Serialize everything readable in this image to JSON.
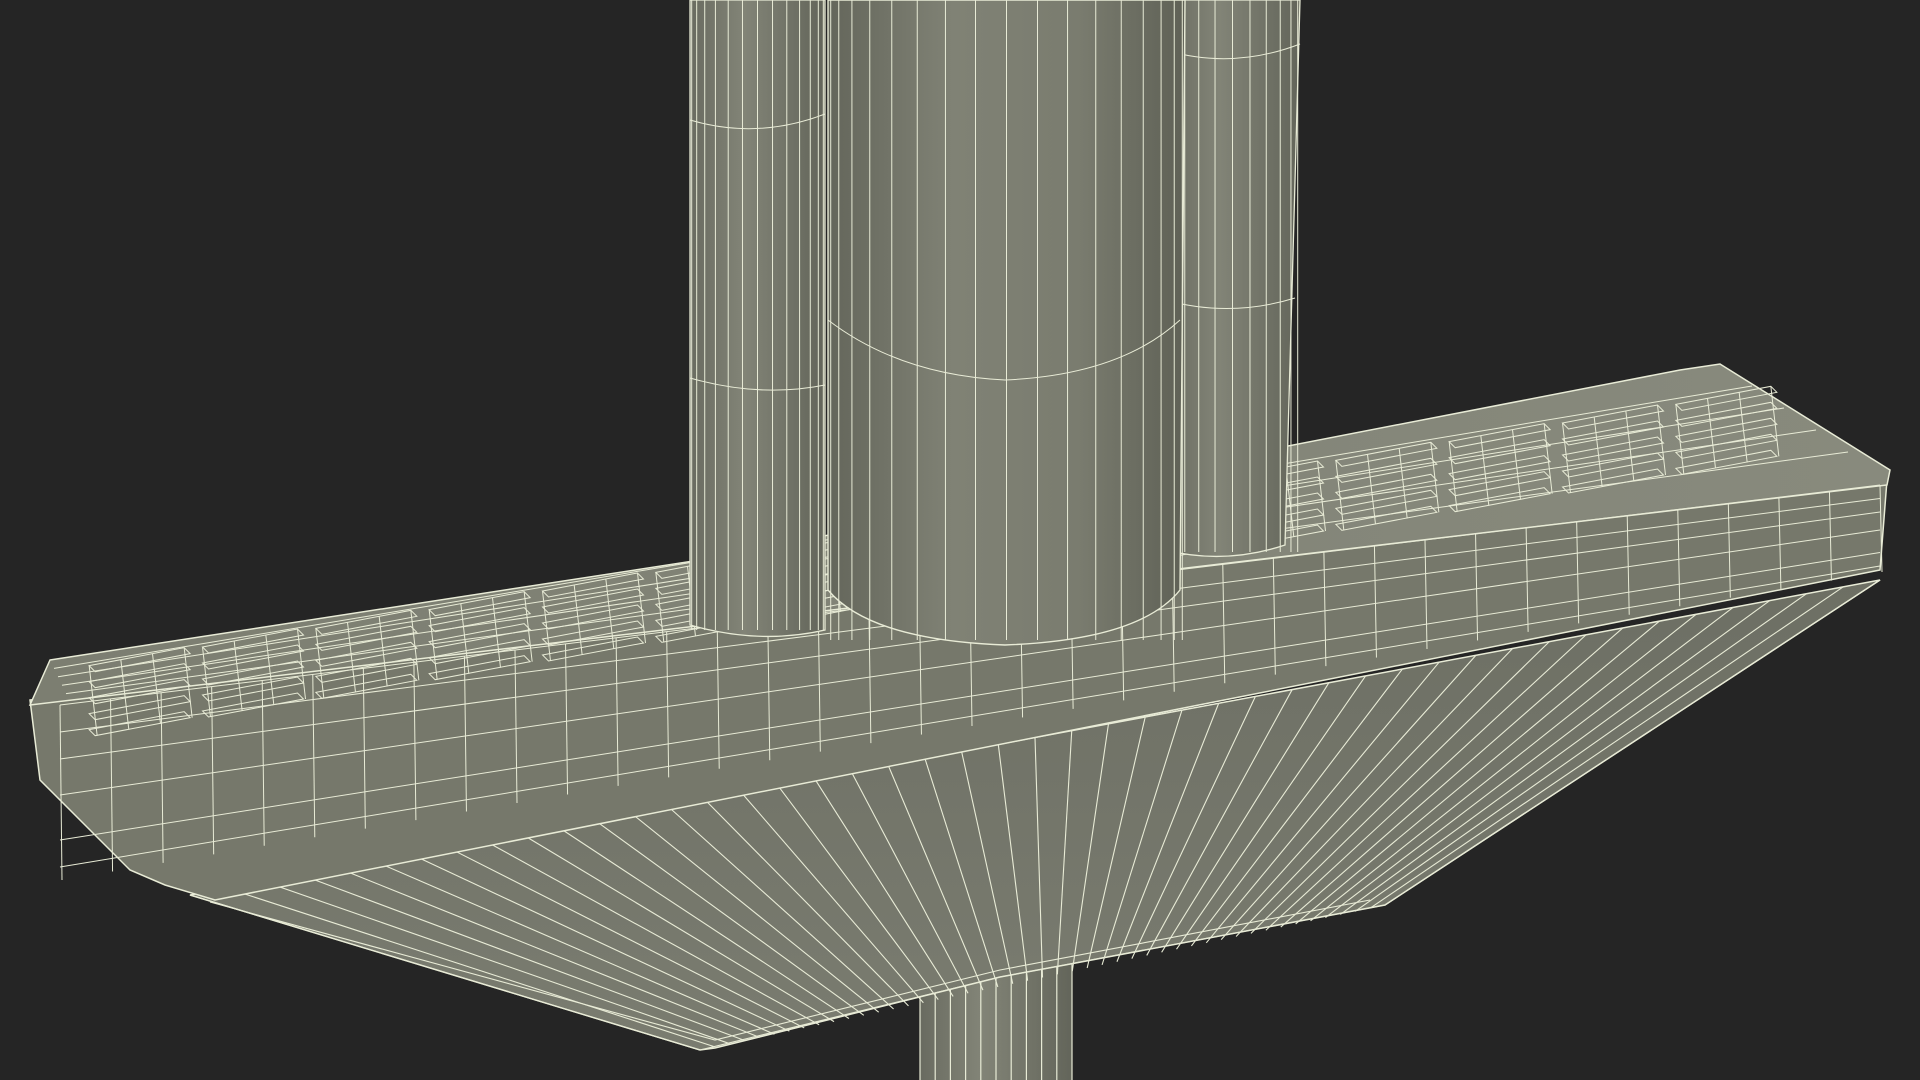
{
  "scene": {
    "subject": "pogo-stick-foot-peg",
    "style": "wireframe-on-shaded",
    "colors": {
      "background": "#252525",
      "surface": "#7b7d70",
      "surface_light": "#85877a",
      "surface_dark": "#6b6d62",
      "edge": "#e8ebd6"
    }
  }
}
